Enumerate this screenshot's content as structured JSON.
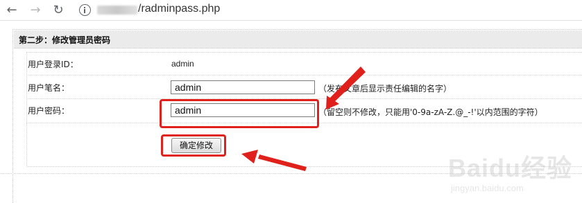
{
  "browser": {
    "url_path": "/radminpass.php",
    "back_glyph": "←",
    "forward_glyph": "→",
    "reload_glyph": "↻"
  },
  "section": {
    "title": "第二步：修改管理员密码"
  },
  "form": {
    "login_id_label": "用户登录ID：",
    "login_id_value": "admin",
    "pen_name_label": "用户笔名：",
    "pen_name_value": "admin",
    "pen_name_hint": "（发布文章后显示责任编辑的名字）",
    "password_label": "用户密码：",
    "password_value": "admin",
    "password_hint": "（留空则不修改，只能用'0-9a-zA-Z.@_-!'以内范围的字符）",
    "submit_label": "确定修改"
  },
  "watermark": {
    "text": "Baidu经验",
    "sub": "jingyan.baidu.com"
  },
  "colors": {
    "annotation": "#e0201b",
    "section_bg": "#ebebeb"
  },
  "icons": [
    "back-arrow-icon",
    "forward-arrow-icon",
    "reload-icon",
    "info-icon"
  ]
}
